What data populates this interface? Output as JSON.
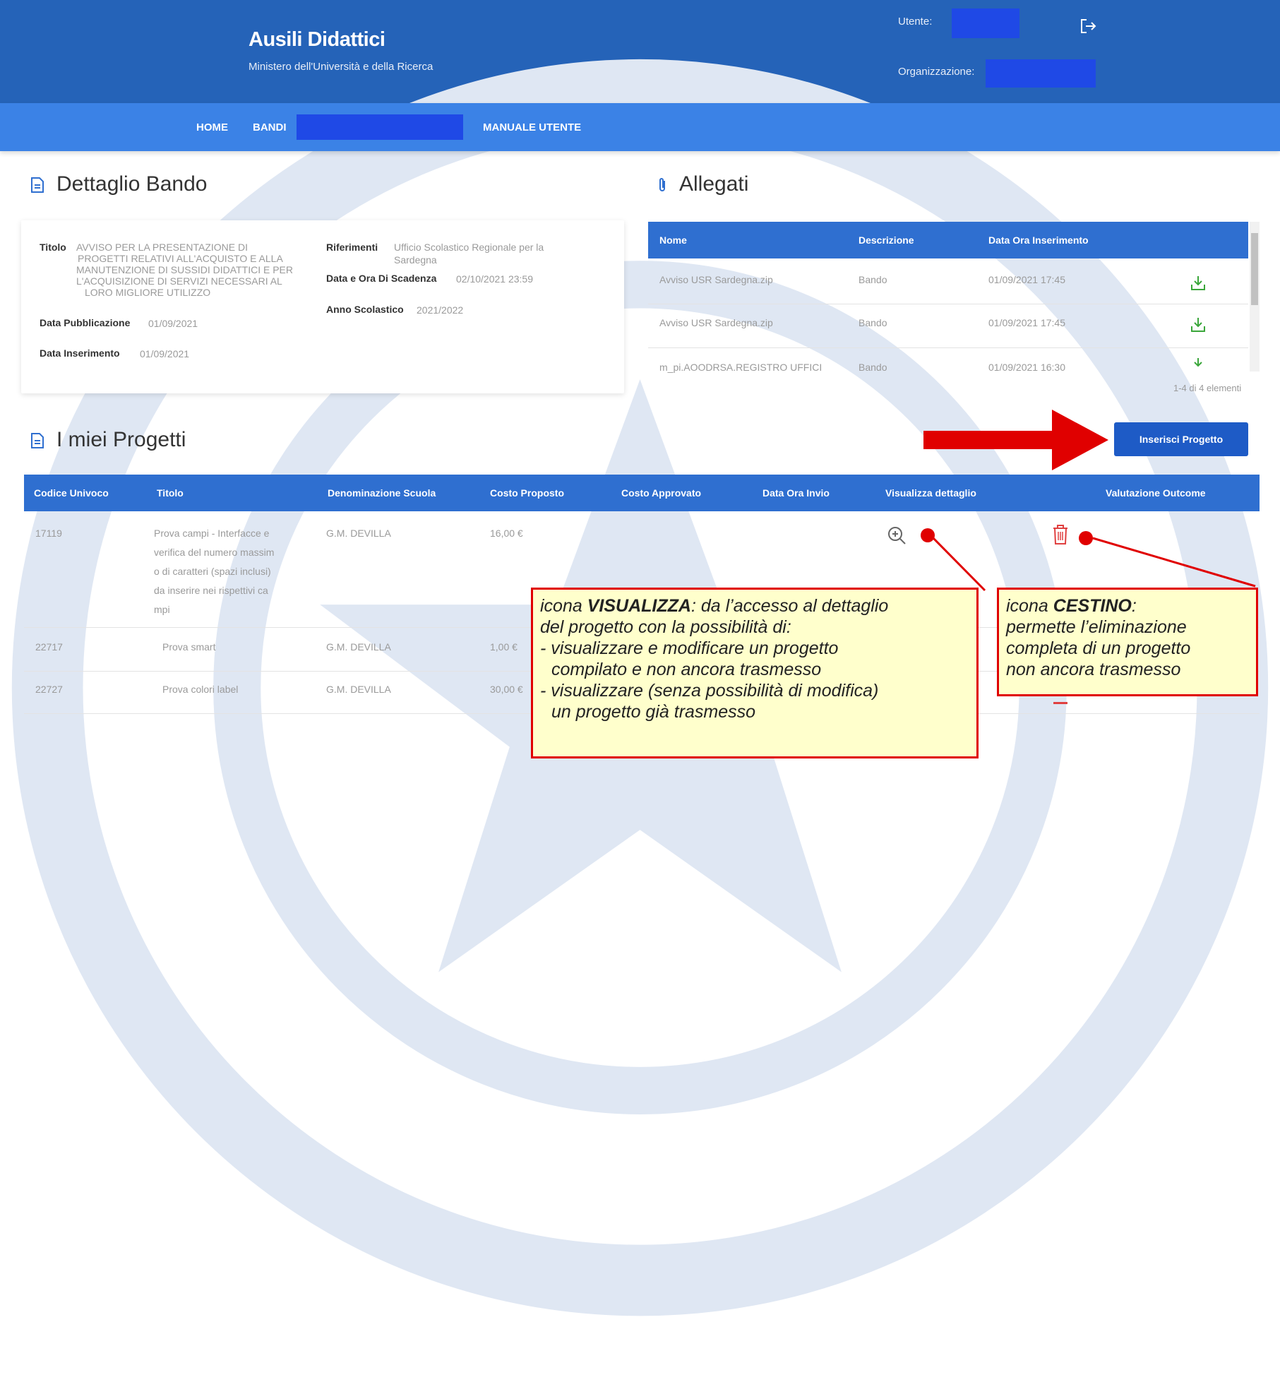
{
  "header": {
    "app_title": "Ausili Didattici",
    "app_subtitle": "Ministero dell'Università e della Ricerca",
    "user_label": "Utente:",
    "org_label": "Organizzazione:"
  },
  "nav": {
    "home": "HOME",
    "bandi": "BANDI",
    "manuale": "MANUALE UTENTE"
  },
  "dettaglio": {
    "section_title": "Dettaglio Bando",
    "titolo_label": "Titolo",
    "titolo_lines": [
      "AVVISO PER LA PRESENTAZIONE DI",
      "PROGETTI RELATIVI ALL'ACQUISTO E ALLA",
      "MANUTENZIONE DI SUSSIDI DIDATTICI E PER",
      "L'ACQUISIZIONE DI SERVIZI NECESSARI AL",
      "LORO MIGLIORE UTILIZZO"
    ],
    "data_pubblicazione_label": "Data Pubblicazione",
    "data_pubblicazione": "01/09/2021",
    "data_inserimento_label": "Data Inserimento",
    "data_inserimento": "01/09/2021",
    "riferimenti_label": "Riferimenti",
    "riferimenti_line1": "Ufficio Scolastico Regionale per la",
    "riferimenti_line2": "Sardegna",
    "scadenza_label": "Data e Ora Di Scadenza",
    "scadenza": "02/10/2021 23:59",
    "anno_label": "Anno Scolastico",
    "anno": "2021/2022"
  },
  "allegati": {
    "section_title": "Allegati",
    "columns": [
      "Nome",
      "Descrizione",
      "Data Ora Inserimento"
    ],
    "rows": [
      [
        "Avviso USR Sardegna.zip",
        "Bando",
        "01/09/2021 17:45"
      ],
      [
        "Avviso USR Sardegna.zip",
        "Bando",
        "01/09/2021 17:45"
      ],
      [
        "m_pi.AOODRSA.REGISTRO UFFICI",
        "Bando",
        "01/09/2021 16:30"
      ]
    ],
    "pager": "1-4 di 4 elementi",
    "download_icon": "download-icon"
  },
  "progetti": {
    "section_title": "I miei Progetti",
    "insert_button": "Inserisci Progetto",
    "columns": [
      "Codice Univoco",
      "Titolo",
      "Denominazione Scuola",
      "Costo Proposto",
      "Costo Approvato",
      "Data Ora Invio",
      "Visualizza dettaglio",
      "Valutazione Outcome"
    ],
    "rows": [
      {
        "codice": "17119",
        "titolo_lines": [
          "Prova campi - Interfacce e",
          "verifica del numero massim",
          "o di caratteri (spazi inclusi)",
          "da inserire nei rispettivi ca",
          "mpi"
        ],
        "scuola": "G.M. DEVILLA",
        "costo": "16,00 €"
      },
      {
        "codice": "22717",
        "titolo_lines": [
          "Prova smart"
        ],
        "scuola": "G.M. DEVILLA",
        "costo": "1,00 €"
      },
      {
        "codice": "22727",
        "titolo_lines": [
          "Prova colori label"
        ],
        "scuola": "G.M. DEVILLA",
        "costo": "30,00 €"
      }
    ]
  },
  "callouts": {
    "visualizza": {
      "prefix": "icona ",
      "keyword": "VISUALIZZA",
      "line1_rest": ": da l’accesso al dettaglio",
      "line2": "del progetto con la possibilità di:",
      "line3": "- visualizzare e modificare un progetto",
      "line4": "compilato e non ancora trasmesso",
      "line5": "- visualizzare (senza possibilità di modifica)",
      "line6": "un progetto già trasmesso"
    },
    "cestino": {
      "prefix": "icona ",
      "keyword": "CESTINO",
      "line1_rest": ":",
      "line2": "permette l’eliminazione",
      "line3": "completa di un progetto",
      "line4": "non ancora trasmesso"
    }
  },
  "colors": {
    "header": "#2563b8",
    "nav": "#3b82e6",
    "table_head": "#2f6fd0",
    "button": "#1e5bc6",
    "annotation_red": "#e00000",
    "callout_bg": "#ffffcc",
    "download_green": "#3aa63a",
    "trash_red": "#e04040"
  }
}
